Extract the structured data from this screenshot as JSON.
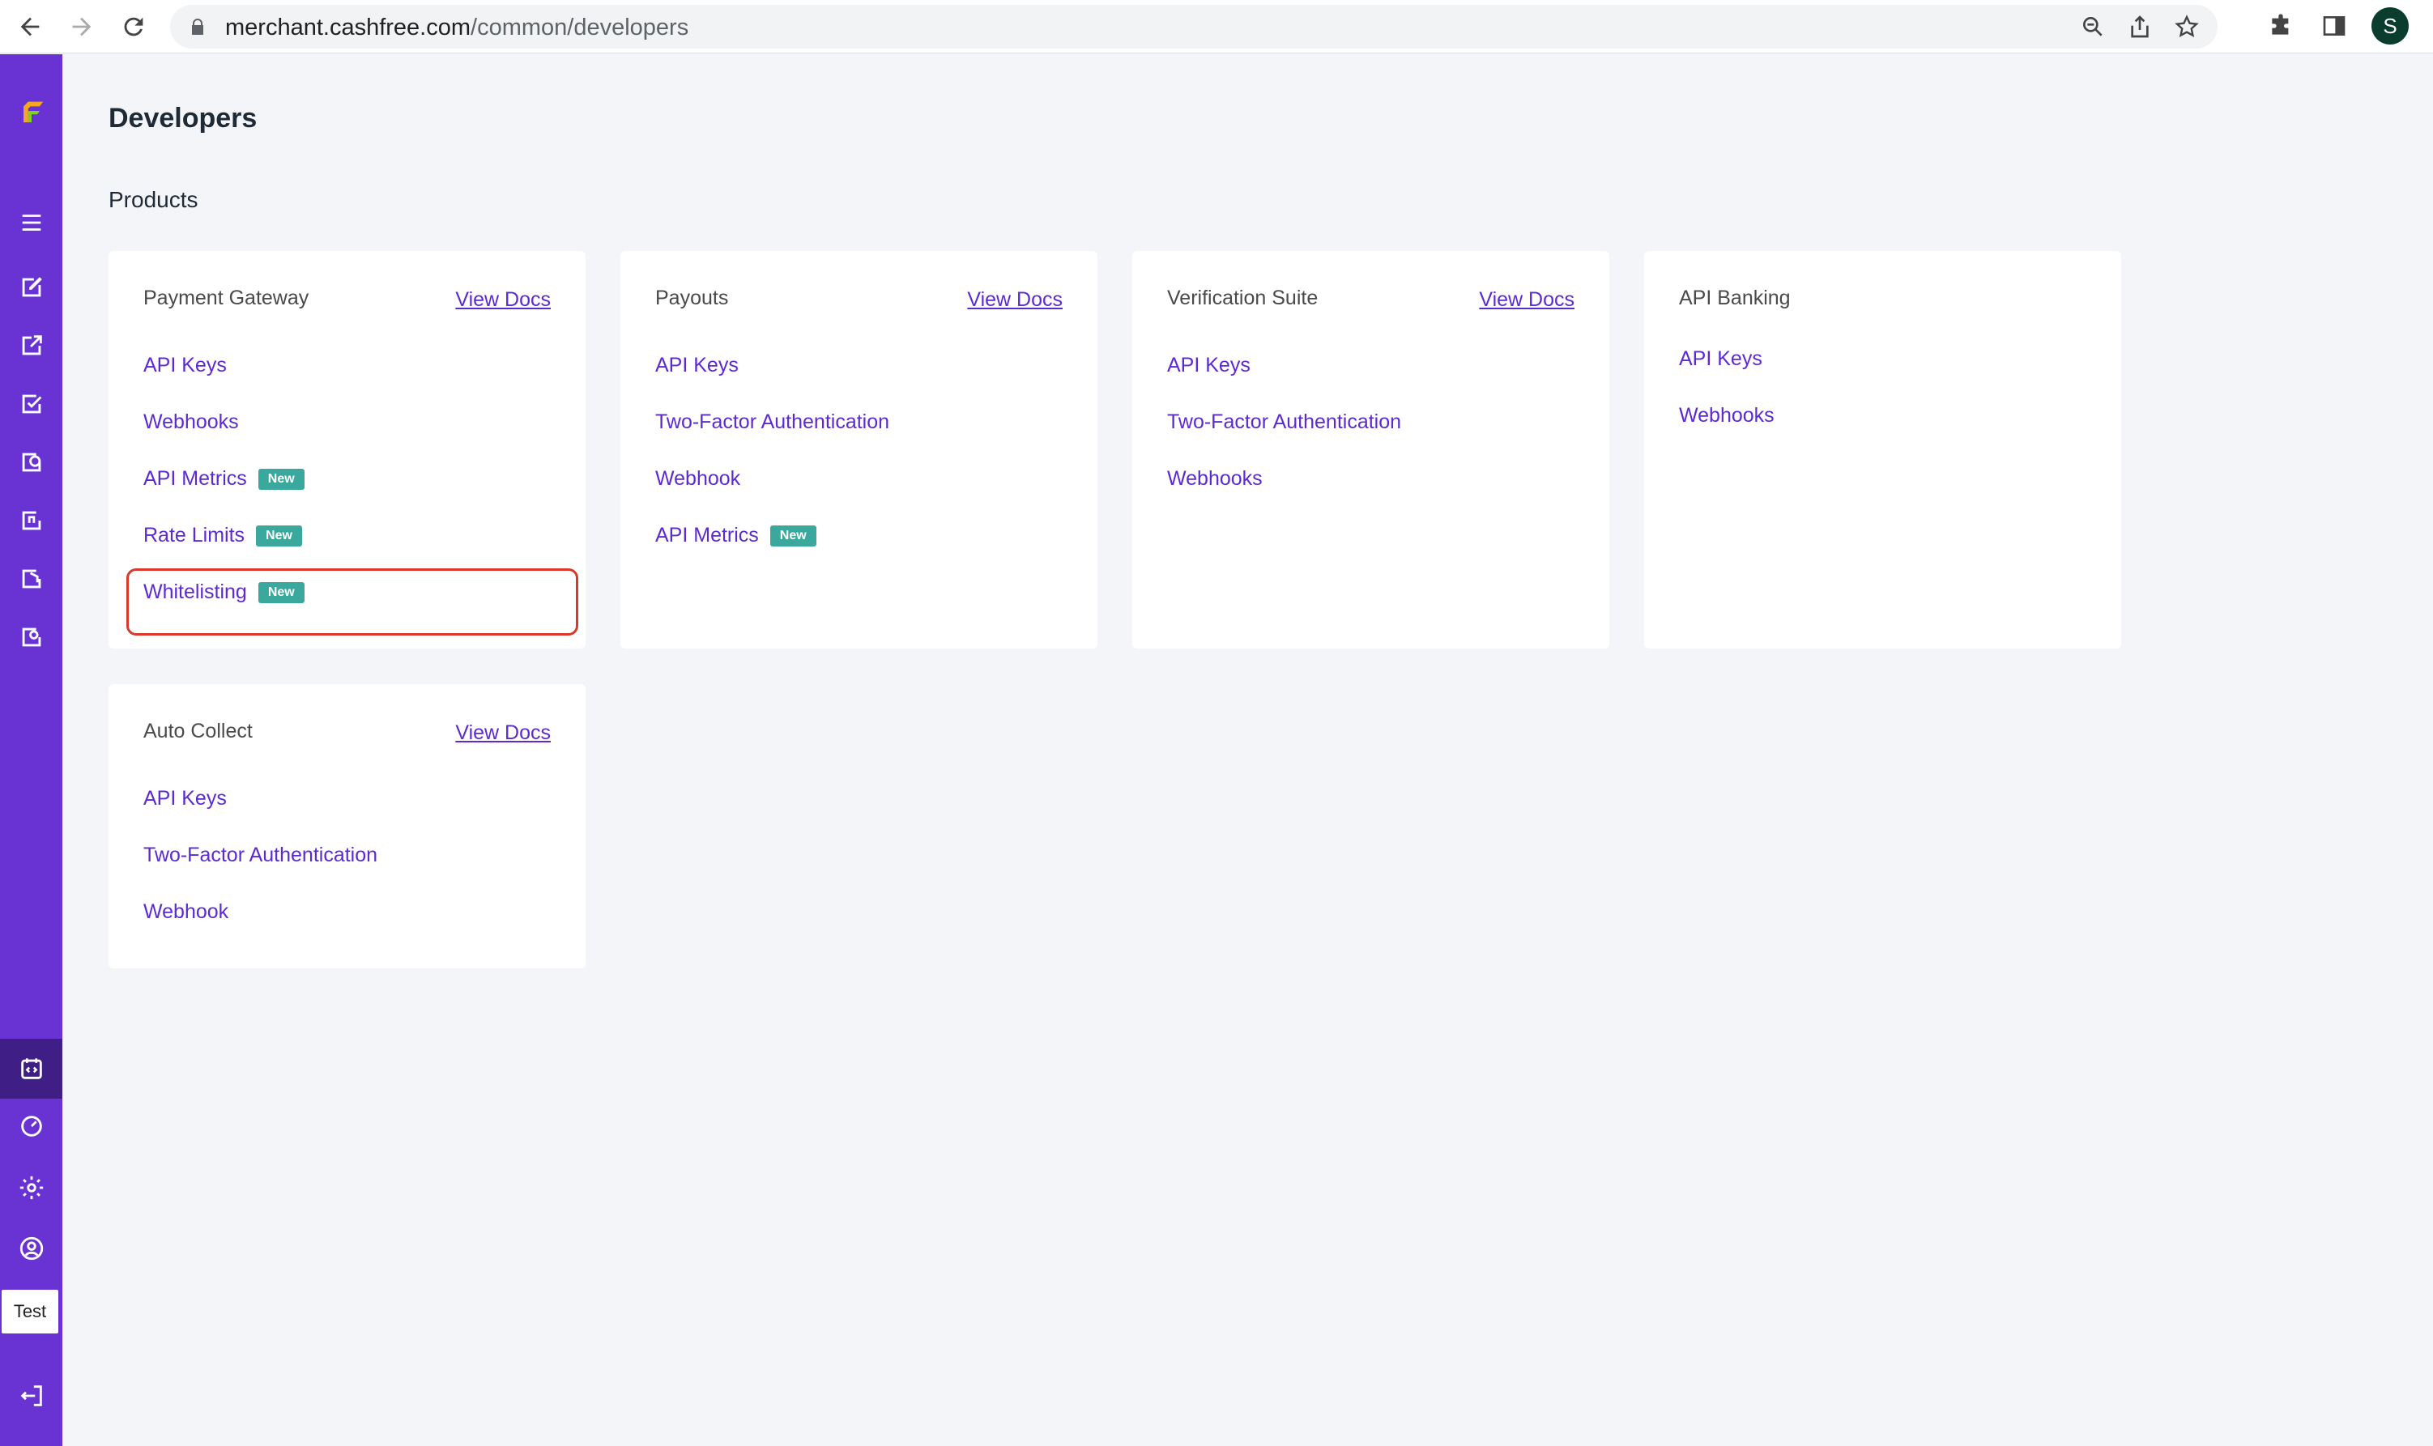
{
  "browser": {
    "url_host": "merchant.cashfree.com",
    "url_path": "/common/developers",
    "profile_initial": "S"
  },
  "sidebar": {
    "test_label": "Test"
  },
  "page": {
    "title": "Developers",
    "section": "Products"
  },
  "cards": [
    {
      "title": "Payment Gateway",
      "view_docs": "View Docs",
      "links": [
        {
          "label": "API Keys",
          "badge": ""
        },
        {
          "label": "Webhooks",
          "badge": ""
        },
        {
          "label": "API Metrics",
          "badge": "New"
        },
        {
          "label": "Rate Limits",
          "badge": "New"
        },
        {
          "label": "Whitelisting",
          "badge": "New"
        }
      ]
    },
    {
      "title": "Payouts",
      "view_docs": "View Docs",
      "links": [
        {
          "label": "API Keys",
          "badge": ""
        },
        {
          "label": "Two-Factor Authentication",
          "badge": ""
        },
        {
          "label": "Webhook",
          "badge": ""
        },
        {
          "label": "API Metrics",
          "badge": "New"
        }
      ]
    },
    {
      "title": "Verification Suite",
      "view_docs": "View Docs",
      "links": [
        {
          "label": "API Keys",
          "badge": ""
        },
        {
          "label": "Two-Factor Authentication",
          "badge": ""
        },
        {
          "label": "Webhooks",
          "badge": ""
        }
      ]
    },
    {
      "title": "API Banking",
      "view_docs": "",
      "links": [
        {
          "label": "API Keys",
          "badge": ""
        },
        {
          "label": "Webhooks",
          "badge": ""
        }
      ]
    },
    {
      "title": "Auto Collect",
      "view_docs": "View Docs",
      "links": [
        {
          "label": "API Keys",
          "badge": ""
        },
        {
          "label": "Two-Factor Authentication",
          "badge": ""
        },
        {
          "label": "Webhook",
          "badge": ""
        }
      ]
    }
  ],
  "colors": {
    "sidebar": "#6933d3",
    "link": "#5b2ad1",
    "badge": "#3aa89d",
    "highlight": "#d8392b"
  }
}
